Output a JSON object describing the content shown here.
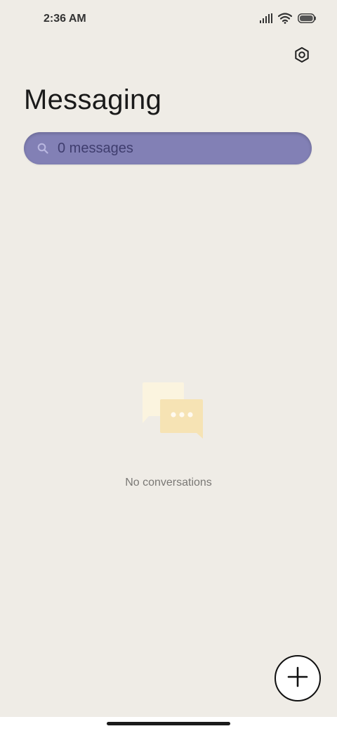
{
  "status_bar": {
    "time": "2:36 AM",
    "icons": [
      "signal-icon",
      "wifi-icon",
      "battery-icon"
    ]
  },
  "header": {
    "title": "Messaging",
    "settings_icon": "settings-hexagon-icon"
  },
  "search": {
    "placeholder": "0 messages",
    "icon": "search-icon",
    "color": "#8280b5"
  },
  "empty_state": {
    "illustration": "chat-bubbles-icon",
    "text": "No conversations"
  },
  "fab": {
    "icon": "plus-icon"
  },
  "colors": {
    "background": "#efece6",
    "accent": "#8280b5",
    "bubble_light": "#fbf4df",
    "bubble_dark": "#f6e3b4"
  }
}
